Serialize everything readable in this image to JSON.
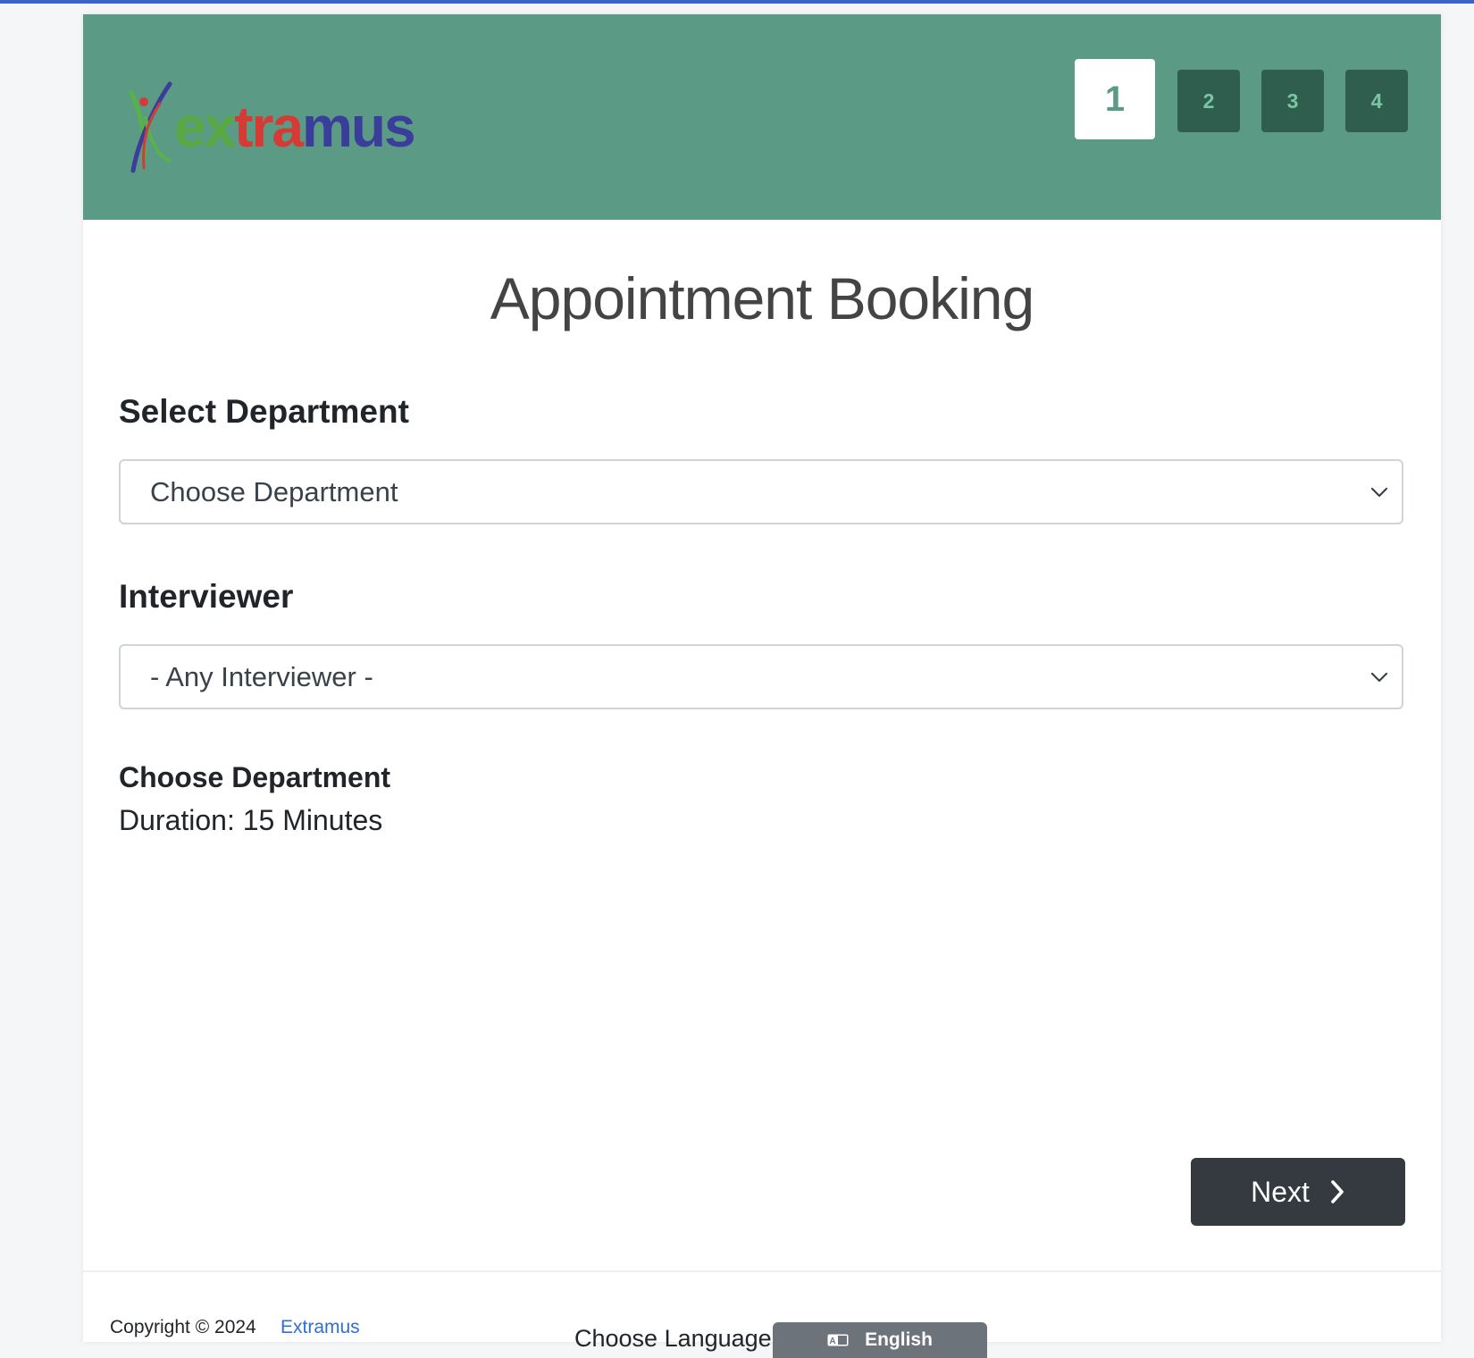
{
  "header": {
    "logo_text": "extramus",
    "steps": [
      "1",
      "2",
      "3",
      "4"
    ],
    "active_step": "1"
  },
  "page_title": "Appointment Booking",
  "department": {
    "label": "Select Department",
    "selected": "Choose Department"
  },
  "interviewer": {
    "label": "Interviewer",
    "selected": "- Any Interviewer -"
  },
  "summary": {
    "title": "Choose Department",
    "duration": "Duration: 15 Minutes"
  },
  "next_button": {
    "label": "Next",
    "icon": "chevron-right-icon"
  },
  "footer": {
    "copyright": "Copyright © 2024",
    "link_text": "Extramus",
    "language_label": "Choose Language",
    "language_button": "English",
    "language_icon": "translate-icon"
  },
  "colors": {
    "header_bg": "#5b9a84",
    "step_inactive_bg": "#2f5e4e",
    "step_inactive_text": "#78c6a4",
    "button_dark": "#343a40",
    "link": "#2f6fd6",
    "language_button_bg": "#6c737a"
  }
}
